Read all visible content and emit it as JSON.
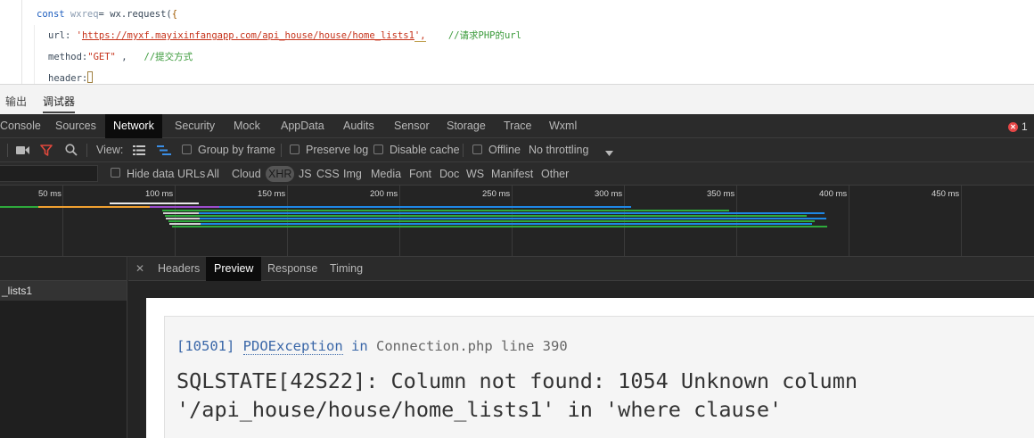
{
  "editor": {
    "line1": {
      "kw": "const",
      "var": " wxreq",
      "rest": "= wx.request(",
      "brace": "{"
    },
    "line2": {
      "key": "url: ",
      "q1": "'",
      "url": "https://myxf.mayixinfangapp.com/api_house/house/home_lists1",
      "q2": "',",
      "comment": "//请求PHP的url"
    },
    "line3": {
      "key": "method:",
      "val": "\"GET\"",
      "sep": " ,",
      "comment": "//提交方式"
    },
    "line4": {
      "key": "header:",
      "brace": "{"
    }
  },
  "panel_tabs": [
    "输出",
    "调试器"
  ],
  "devtools_tabs": [
    "Console",
    "Sources",
    "Network",
    "Security",
    "Mock",
    "AppData",
    "Audits",
    "Sensor",
    "Storage",
    "Trace",
    "Wxml"
  ],
  "error_count": "1",
  "toolbar": {
    "view_label": "View:",
    "group_by_frame": "Group by frame",
    "preserve_log": "Preserve log",
    "disable_cache": "Disable cache",
    "offline": "Offline",
    "throttling": "No throttling"
  },
  "filter": {
    "hide_data_urls": "Hide data URLs",
    "types": [
      "All",
      "Cloud",
      "XHR",
      "JS",
      "CSS",
      "Img",
      "Media",
      "Font",
      "Doc",
      "WS",
      "Manifest",
      "Other"
    ],
    "active_type": "XHR"
  },
  "timeline_ticks": [
    "50 ms",
    "100 ms",
    "150 ms",
    "200 ms",
    "250 ms",
    "300 ms",
    "350 ms",
    "400 ms",
    "450 ms"
  ],
  "request_list": {
    "row": "_lists1"
  },
  "detail_tabs": [
    "Headers",
    "Preview",
    "Response",
    "Timing"
  ],
  "active_detail_tab": "Preview",
  "preview": {
    "code": "[10501]",
    "exception": "PDOException",
    "in": "in",
    "file": "Connection.php line 390",
    "message": "SQLSTATE[42S22]: Column not found: 1054 Unknown column '/api_house/house/home_lists1' in 'where clause'"
  },
  "colors": {
    "devtools_bg": "#242424",
    "active_tab_bg": "#0c0c0c",
    "error_red": "#e54646",
    "filter_icon_red": "#e0483c",
    "waterfall_blue": "#1e88e5",
    "waterfall_green": "#2eaa3c",
    "waterfall_purple": "#9c4dcc",
    "waterfall_orange": "#f0a030"
  }
}
